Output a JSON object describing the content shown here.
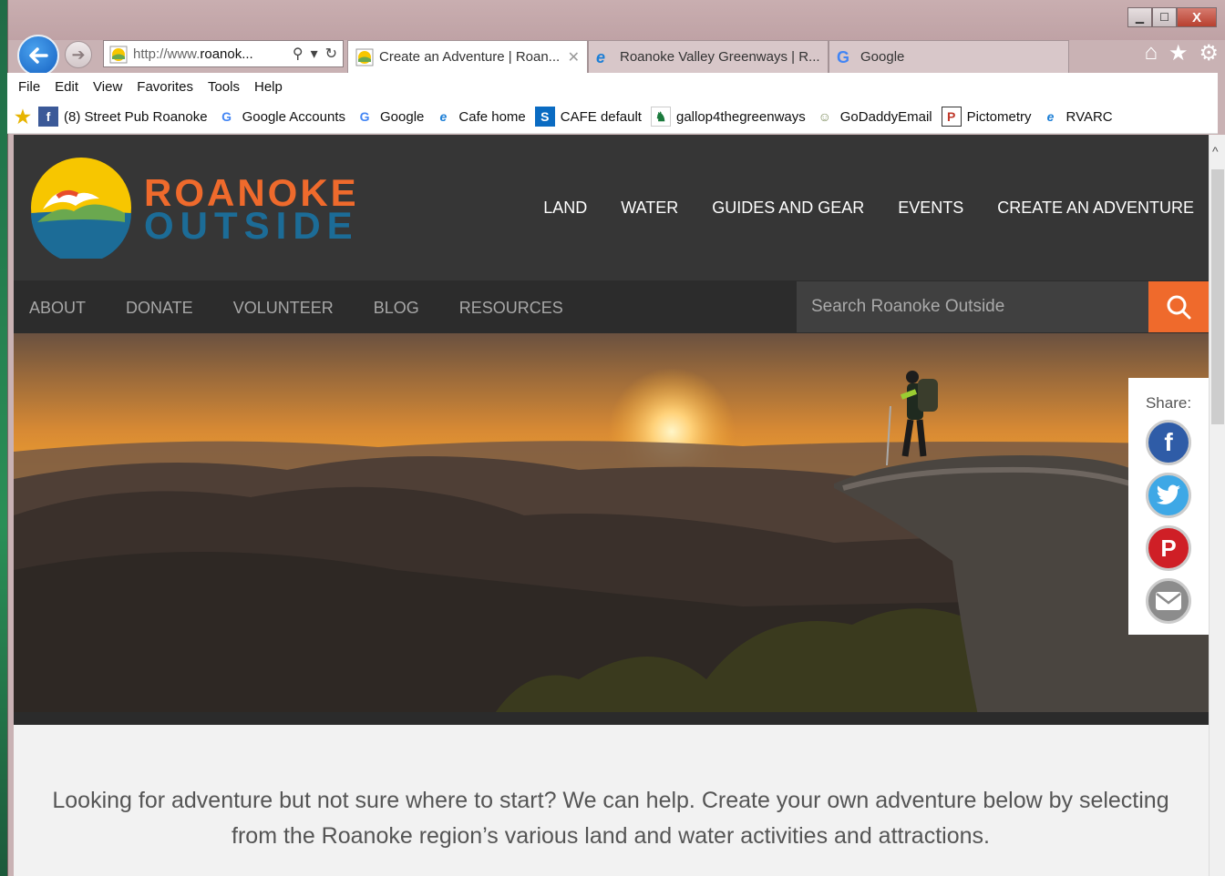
{
  "browser": {
    "address": {
      "prefix": "http://www.",
      "domain": "roanok..."
    },
    "tabs": [
      {
        "label": "Create an Adventure | Roan...",
        "active": true
      },
      {
        "label": "Roanoke Valley Greenways | R...",
        "active": false
      },
      {
        "label": "Google",
        "active": false
      }
    ],
    "close_glyph": "✕",
    "menu": [
      "File",
      "Edit",
      "View",
      "Favorites",
      "Tools",
      "Help"
    ],
    "favorites": [
      {
        "label": "(8) Street Pub Roanoke",
        "icon": "facebook-icon"
      },
      {
        "label": "Google Accounts",
        "icon": "google-icon"
      },
      {
        "label": "Google",
        "icon": "google-icon"
      },
      {
        "label": "Cafe home",
        "icon": "ie-page-icon"
      },
      {
        "label": "CAFE default",
        "icon": "sharepoint-icon"
      },
      {
        "label": "gallop4thegreenways",
        "icon": "horse-icon"
      },
      {
        "label": "GoDaddyEmail",
        "icon": "godaddy-icon"
      },
      {
        "label": "Pictometry",
        "icon": "pictometry-icon"
      },
      {
        "label": "RVARC",
        "icon": "ie-page-icon"
      }
    ],
    "window_buttons": {
      "minimize": "▁",
      "maximize": "☐",
      "close": "X"
    }
  },
  "site": {
    "brand": {
      "line1": "ROANOKE",
      "line2": "OUTSIDE"
    },
    "main_nav": [
      "LAND",
      "WATER",
      "GUIDES AND GEAR",
      "EVENTS",
      "CREATE AN ADVENTURE"
    ],
    "sub_nav": [
      "ABOUT",
      "DONATE",
      "VOLUNTEER",
      "BLOG",
      "RESOURCES"
    ],
    "search": {
      "placeholder": "Search Roanoke Outside"
    },
    "share": {
      "label": "Share:",
      "networks": [
        "facebook",
        "twitter",
        "pinterest",
        "email"
      ]
    },
    "intro": "Looking for adventure but not sure where to start? We can help. Create your own adventure below by selecting from the Roanoke region’s various land and water activities and attractions."
  },
  "colors": {
    "accent_orange": "#ef6a2c",
    "brand_blue": "#1c6c97",
    "header_dark": "#363636"
  }
}
